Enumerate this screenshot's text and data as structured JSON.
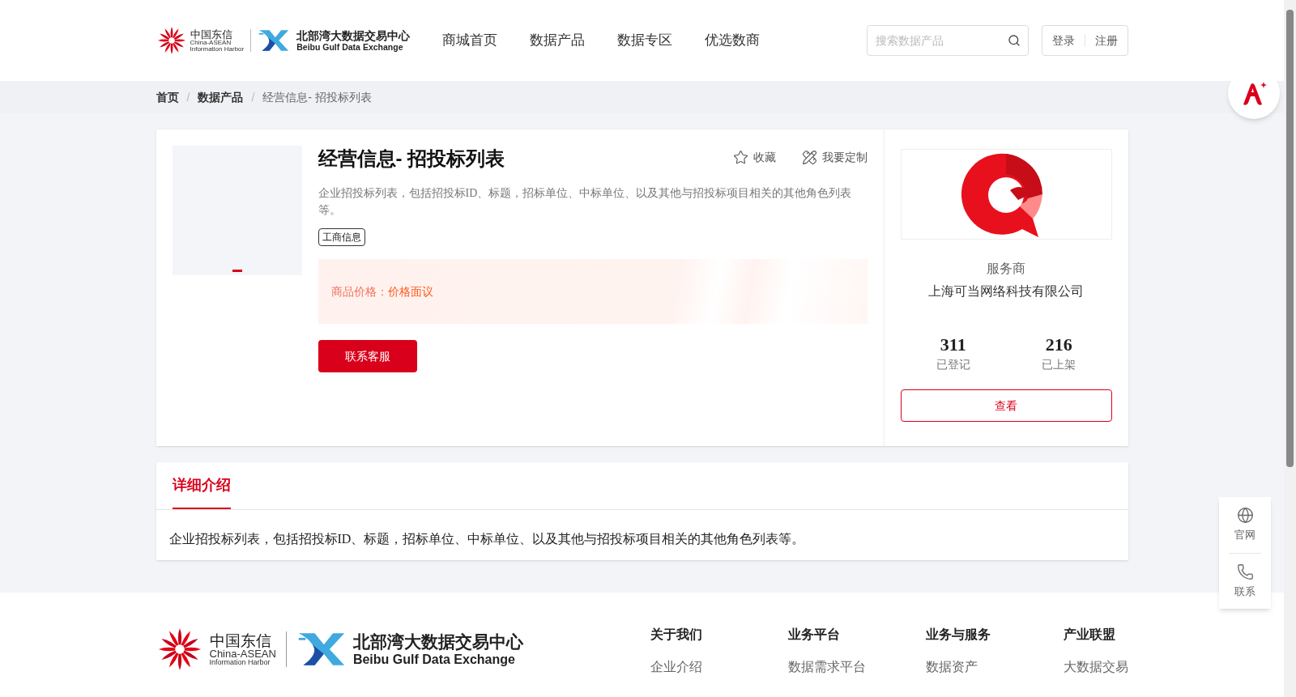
{
  "header": {
    "logo": {
      "cn": "中国东信",
      "en_1": "China-ASEAN",
      "en_2": "Information Harbor",
      "exchange_cn": "北部湾大数据交易中心",
      "exchange_en": "Beibu Gulf Data Exchange"
    },
    "nav": [
      "商城首页",
      "数据产品",
      "数据专区",
      "优选数商"
    ],
    "search": {
      "placeholder": "搜索数据产品"
    },
    "auth": [
      "登录",
      "注册"
    ]
  },
  "breadcrumb": {
    "separator": "/",
    "items": [
      "首页",
      "数据产品",
      "经营信息- 招投标列表"
    ]
  },
  "product": {
    "title": "经营信息- 招投标列表",
    "actions": [
      {
        "kind": "favorite",
        "label": "收藏"
      },
      {
        "kind": "customize",
        "label": "我要定制"
      }
    ],
    "description": "企业招投标列表，包括招投标ID、标题，招标单位、中标单位、以及其他与招投标项目相关的其他角色列表等。",
    "tag": "工商信息",
    "price_label": "商品价格：",
    "price_value": "价格面议",
    "button": "联系客服"
  },
  "provider": {
    "label": "服务商",
    "name": "上海可当网络科技有限公司",
    "stats": [
      {
        "value": "311",
        "label": "已登记"
      },
      {
        "value": "216",
        "label": "已上架"
      }
    ],
    "button": "查看"
  },
  "details": {
    "tabs": [
      {
        "label": "详细介绍",
        "selected": true
      }
    ],
    "text": "企业招投标列表，包括招投标ID、标题，招标单位、中标单位、以及其他与招投标项目相关的其他角色列表等。"
  },
  "side_panel": [
    {
      "kind": "globe",
      "label": "官网"
    },
    {
      "kind": "phone",
      "label": "联系"
    }
  ],
  "footer": {
    "logo": {
      "cn": "中国东信",
      "en_1": "China-ASEAN",
      "en_2": "Information Harbor",
      "exchange_cn": "北部湾大数据交易中心",
      "exchange_en": "Beibu Gulf Data Exchange"
    },
    "columns": [
      {
        "heading": "关于我们",
        "links": [
          "企业介绍"
        ]
      },
      {
        "heading": "业务平台",
        "links": [
          "数据需求平台"
        ]
      },
      {
        "heading": "业务与服务",
        "links": [
          "数据资产"
        ]
      },
      {
        "heading": "产业联盟",
        "links": [
          "大数据交易"
        ]
      }
    ]
  }
}
